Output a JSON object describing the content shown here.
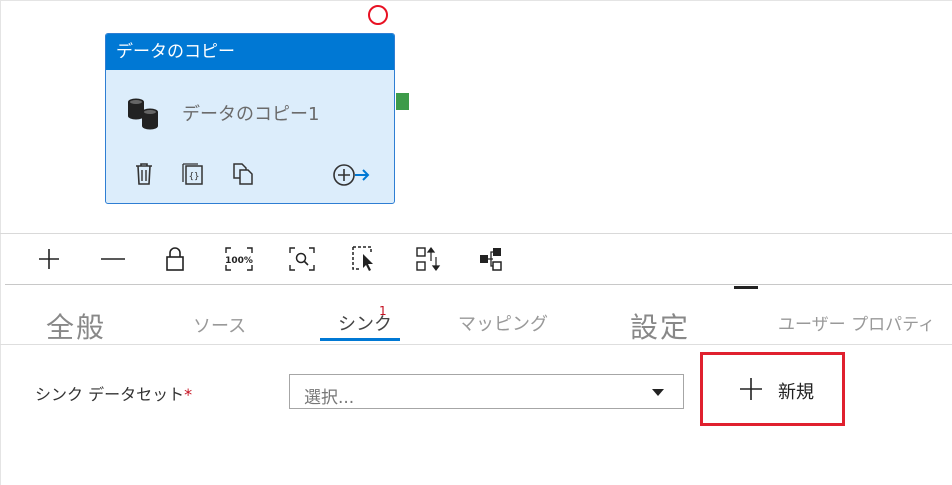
{
  "canvas": {
    "activity": {
      "header_title": "データのコピー",
      "name": "データのコピー1"
    },
    "actions": {
      "delete_icon": "trash-icon",
      "code_icon": "code-icon",
      "clone_icon": "clone-icon",
      "add_output_icon": "add-output-icon"
    }
  },
  "toolbar": {
    "zoom_in": "plus-icon",
    "zoom_out": "minus-icon",
    "lock": "lock-icon",
    "zoom_100_label": "100%",
    "zoom_to_fit": "zoom-fit-icon",
    "select": "select-icon",
    "auto_align": "auto-align-icon",
    "layout": "layout-icon"
  },
  "tabs": {
    "general": "全般",
    "source": "ソース",
    "sink": "シンク",
    "sink_badge": "1",
    "mapping": "マッピング",
    "settings": "設定",
    "user_properties": "ユーザー プロパティ"
  },
  "form": {
    "sink_dataset_label": "シンク データセット",
    "required_marker": "*",
    "select_placeholder": "選択...",
    "new_button_label": "新規"
  },
  "colors": {
    "activity_header": "#0078d4",
    "activity_body": "#dcedfb",
    "handle": "#3d9b4a",
    "highlight": "#e0202e",
    "tab_underline": "#0078d4"
  }
}
